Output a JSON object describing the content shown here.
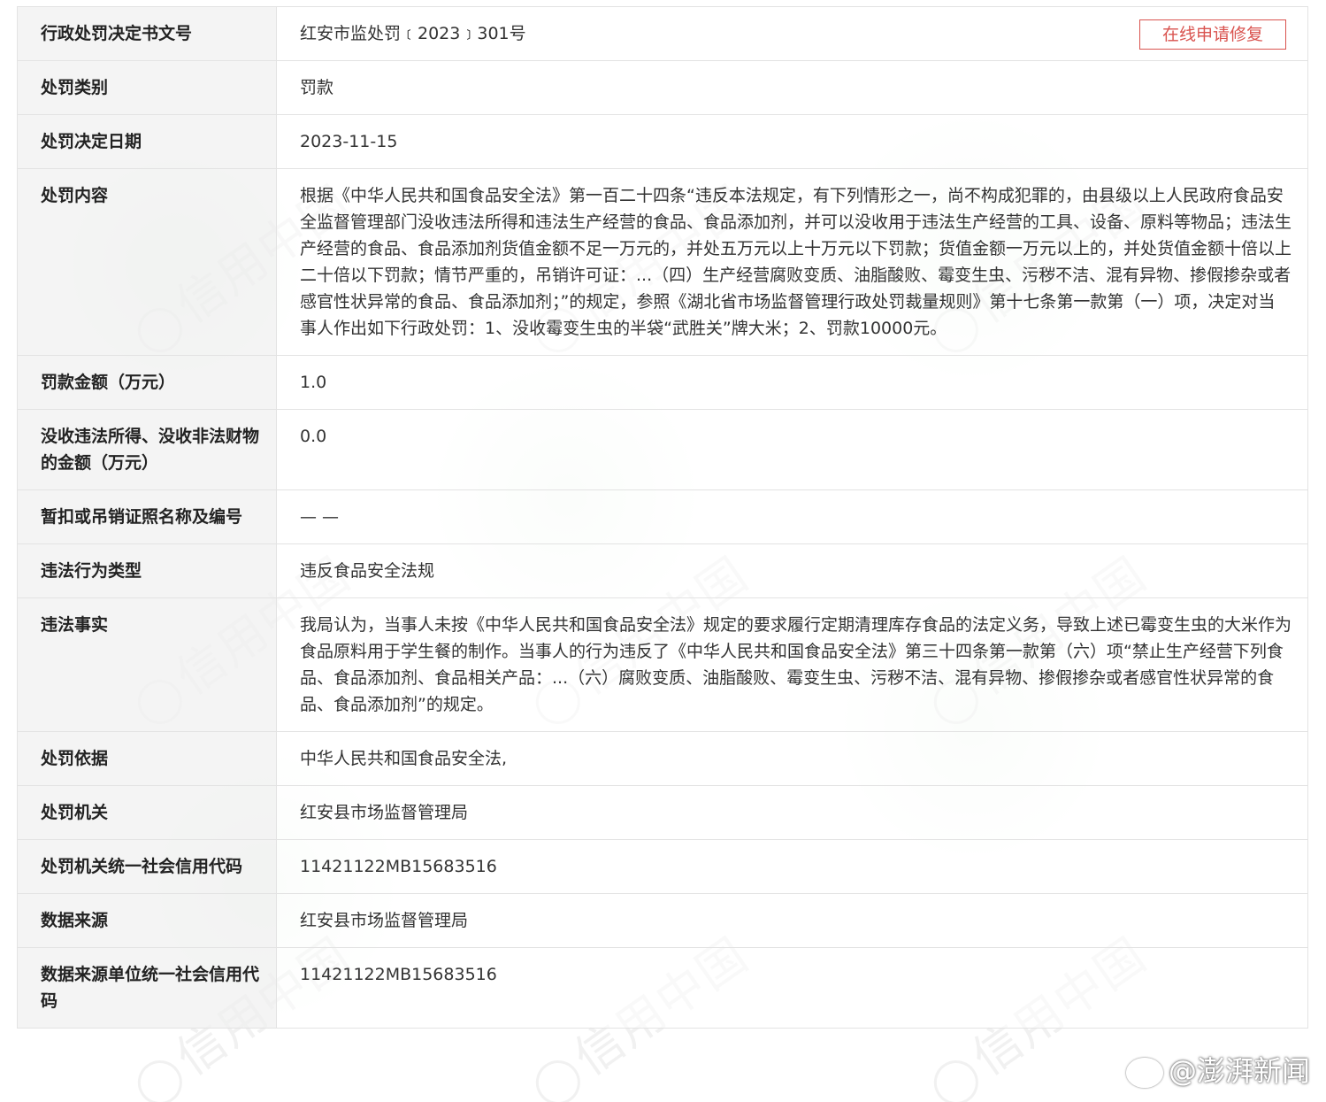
{
  "rows": [
    {
      "label": "行政处罚决定书文号",
      "value": "红安市监处罚﹝2023﹞301号"
    },
    {
      "label": "处罚类别",
      "value": "罚款"
    },
    {
      "label": "处罚决定日期",
      "value": "2023-11-15"
    },
    {
      "label": "处罚内容",
      "value": "根据《中华人民共和国食品安全法》第一百二十四条“违反本法规定，有下列情形之一，尚不构成犯罪的，由县级以上人民政府食品安全监督管理部门没收违法所得和违法生产经营的食品、食品添加剂，并可以没收用于违法生产经营的工具、设备、原料等物品；违法生产经营的食品、食品添加剂货值金额不足一万元的，并处五万元以上十万元以下罚款；货值金额一万元以上的，并处货值金额十倍以上二十倍以下罚款；情节严重的，吊销许可证：...（四）生产经营腐败变质、油脂酸败、霉变生虫、污秽不洁、混有异物、掺假掺杂或者感官性状异常的食品、食品添加剂；”的规定，参照《湖北省市场监督管理行政处罚裁量规则》第十七条第一款第（一）项，决定对当事人作出如下行政处罚：1、没收霉变生虫的半袋“武胜关”牌大米；2、罚款10000元。"
    },
    {
      "label": "罚款金额（万元）",
      "value": "1.0"
    },
    {
      "label": "没收违法所得、没收非法财物的金额（万元）",
      "value": "0.0"
    },
    {
      "label": "暂扣或吊销证照名称及编号",
      "value": "— —"
    },
    {
      "label": "违法行为类型",
      "value": "违反食品安全法规"
    },
    {
      "label": "违法事实",
      "value": "我局认为，当事人未按《中华人民共和国食品安全法》规定的要求履行定期清理库存食品的法定义务，导致上述已霉变生虫的大米作为食品原料用于学生餐的制作。当事人的行为违反了《中华人民共和国食品安全法》第三十四条第一款第（六）项“禁止生产经营下列食品、食品添加剂、食品相关产品：...（六）腐败变质、油脂酸败、霉变生虫、污秽不洁、混有异物、掺假掺杂或者感官性状异常的食品、食品添加剂”的规定。"
    },
    {
      "label": "处罚依据",
      "value": "中华人民共和国食品安全法,"
    },
    {
      "label": "处罚机关",
      "value": "红安县市场监督管理局"
    },
    {
      "label": "处罚机关统一社会信用代码",
      "value": "11421122MB15683516"
    },
    {
      "label": "数据来源",
      "value": "红安县市场监督管理局"
    },
    {
      "label": "数据来源单位统一社会信用代码",
      "value": "11421122MB15683516"
    }
  ],
  "repair_button_label": "在线申请修复",
  "watermark_text": "信用中国",
  "brand_text": "@澎湃新闻",
  "colors": {
    "accent_red": "#d9534f",
    "label_bg": "#f0f0f0",
    "border": "#e3e3e3"
  }
}
